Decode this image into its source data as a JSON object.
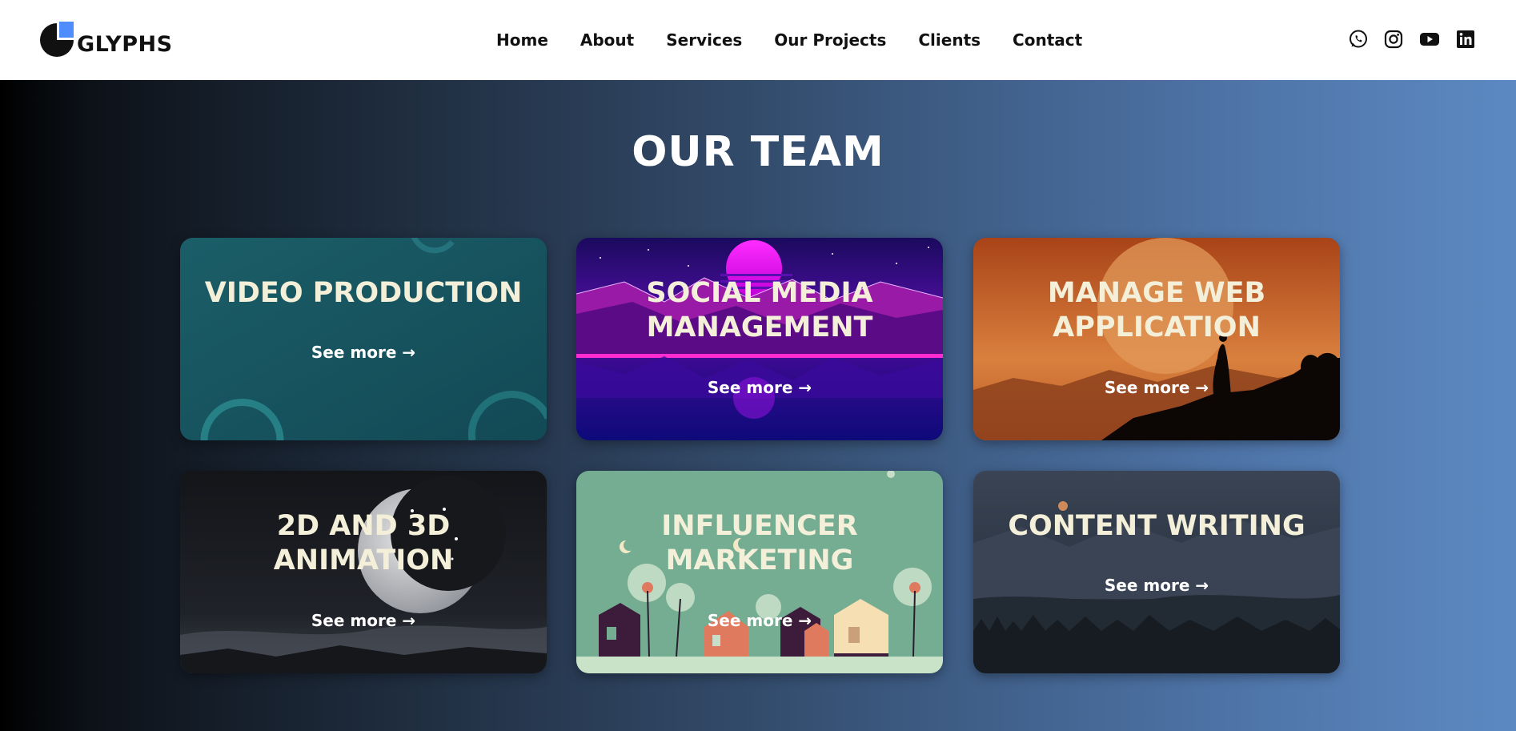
{
  "brand": {
    "name": "GLYPHS",
    "logo_colors": {
      "dark": "#111111",
      "accent": "#4f8dfd"
    }
  },
  "nav": {
    "items": [
      {
        "label": "Home"
      },
      {
        "label": "About"
      },
      {
        "label": "Services"
      },
      {
        "label": "Our Projects"
      },
      {
        "label": "Clients"
      },
      {
        "label": "Contact"
      }
    ]
  },
  "social": {
    "icons": [
      "whatsapp-icon",
      "instagram-icon",
      "youtube-icon",
      "linkedin-icon"
    ]
  },
  "section": {
    "title": "OUR TEAM"
  },
  "cards": [
    {
      "title": "VIDEO PRODUCTION",
      "link": "See more →",
      "theme": "#17515c"
    },
    {
      "title": "SOCIAL MEDIA\nMANAGEMENT",
      "link": "See more →",
      "theme": "#3b0aa0"
    },
    {
      "title": "MANAGE WEB\nAPPLICATION",
      "link": "See more →",
      "theme": "#c86a32"
    },
    {
      "title": "2D AND 3D\nANIMATION",
      "link": "See more →",
      "theme": "#16171b"
    },
    {
      "title": "INFLUENCER\nMARKETING",
      "link": "See more →",
      "theme": "#74ad92"
    },
    {
      "title": "CONTENT WRITING",
      "link": "See more →",
      "theme": "#2b3442"
    }
  ]
}
